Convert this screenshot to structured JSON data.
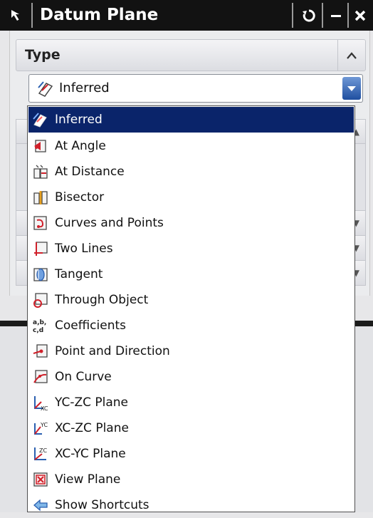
{
  "window": {
    "title": "Datum Plane"
  },
  "type_section": {
    "label": "Type",
    "selected": "Inferred"
  },
  "dropdown": {
    "items": [
      {
        "label": "Inferred",
        "icon": "inferred-icon",
        "selected": true
      },
      {
        "label": "At Angle",
        "icon": "at-angle-icon"
      },
      {
        "label": "At Distance",
        "icon": "at-distance-icon"
      },
      {
        "label": "Bisector",
        "icon": "bisector-icon"
      },
      {
        "label": "Curves and Points",
        "icon": "curves-and-points-icon"
      },
      {
        "label": "Two Lines",
        "icon": "two-lines-icon"
      },
      {
        "label": "Tangent",
        "icon": "tangent-icon"
      },
      {
        "label": "Through Object",
        "icon": "through-object-icon"
      },
      {
        "label": "Coefficients",
        "icon": "coefficients-icon"
      },
      {
        "label": "Point and Direction",
        "icon": "point-and-direction-icon"
      },
      {
        "label": "On Curve",
        "icon": "on-curve-icon"
      },
      {
        "label": "YC-ZC Plane",
        "icon": "yc-zc-plane-icon"
      },
      {
        "label": "XC-ZC Plane",
        "icon": "xc-zc-plane-icon"
      },
      {
        "label": "XC-YC Plane",
        "icon": "xc-yc-plane-icon"
      },
      {
        "label": "View Plane",
        "icon": "view-plane-icon"
      },
      {
        "label": "Show Shortcuts",
        "icon": "show-shortcuts-icon"
      }
    ]
  },
  "colors": {
    "titlebar": "#121212",
    "selection": "#0a246a",
    "icon_red": "#d0202a",
    "icon_blue": "#2a5fb0"
  }
}
